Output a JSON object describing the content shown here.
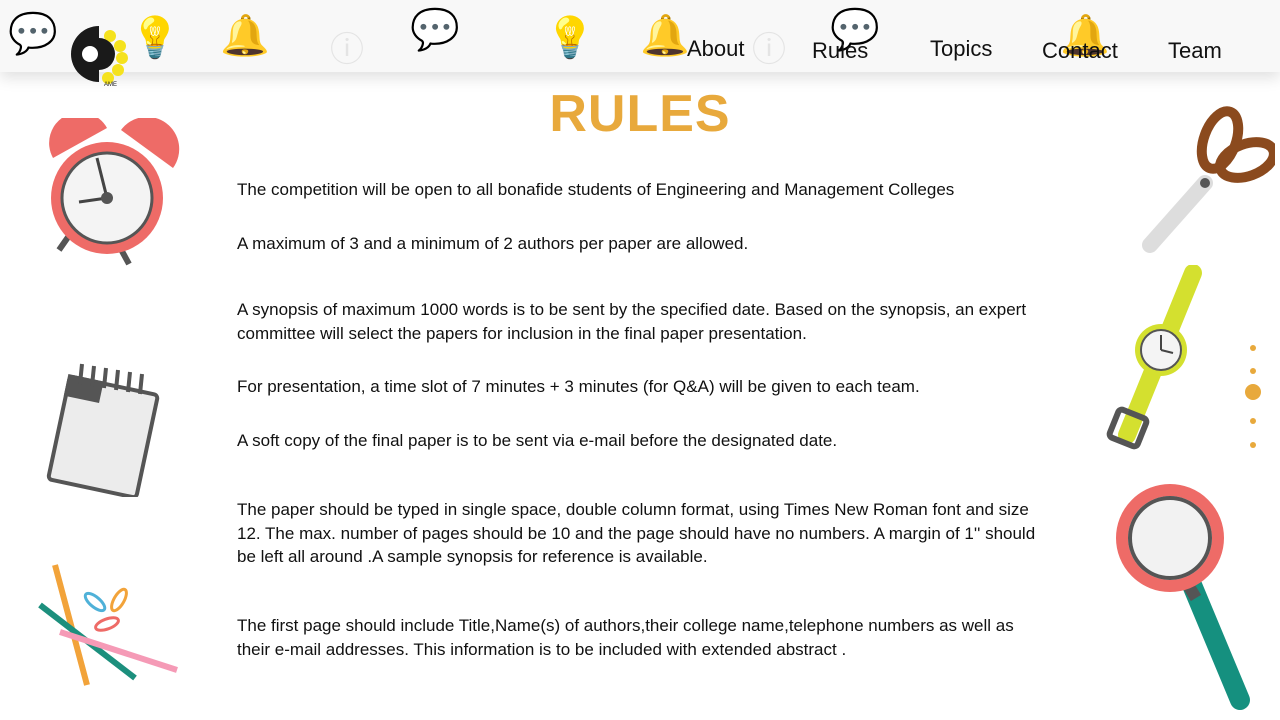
{
  "header": {
    "logo_text": "AME",
    "nav": [
      {
        "label": "About"
      },
      {
        "label": "Rules"
      },
      {
        "label": "Topics"
      },
      {
        "label": "Contact"
      },
      {
        "label": "Team"
      }
    ]
  },
  "page_title": "RULES",
  "rules": [
    "The competition will be open to all bonafide students of Engineering and Management Colleges",
    "A maximum of 3 and a minimum of 2 authors per paper are allowed.",
    "A synopsis of maximum 1000 words is to be sent by the specified date. Based on the synopsis, an expert committee will select the papers for inclusion in the final paper presentation.",
    "For presentation, a time slot of 7 minutes + 3 minutes (for Q&A) will be given to each team.",
    "A soft copy of the final paper is to be sent via e-mail before the designated date.",
    "The paper should be typed in single space, double column format, using Times New Roman font and size 12. The max. number of pages should be 10 and the page should have no numbers. A margin of 1'' should be left all around .A sample synopsis for reference is available.",
    "The first page should include Title,Name(s) of authors,their college name,telephone numbers as well as their e-mail addresses. This information is to be included with extended abstract ."
  ],
  "colors": {
    "accent": "#e8a93c"
  }
}
